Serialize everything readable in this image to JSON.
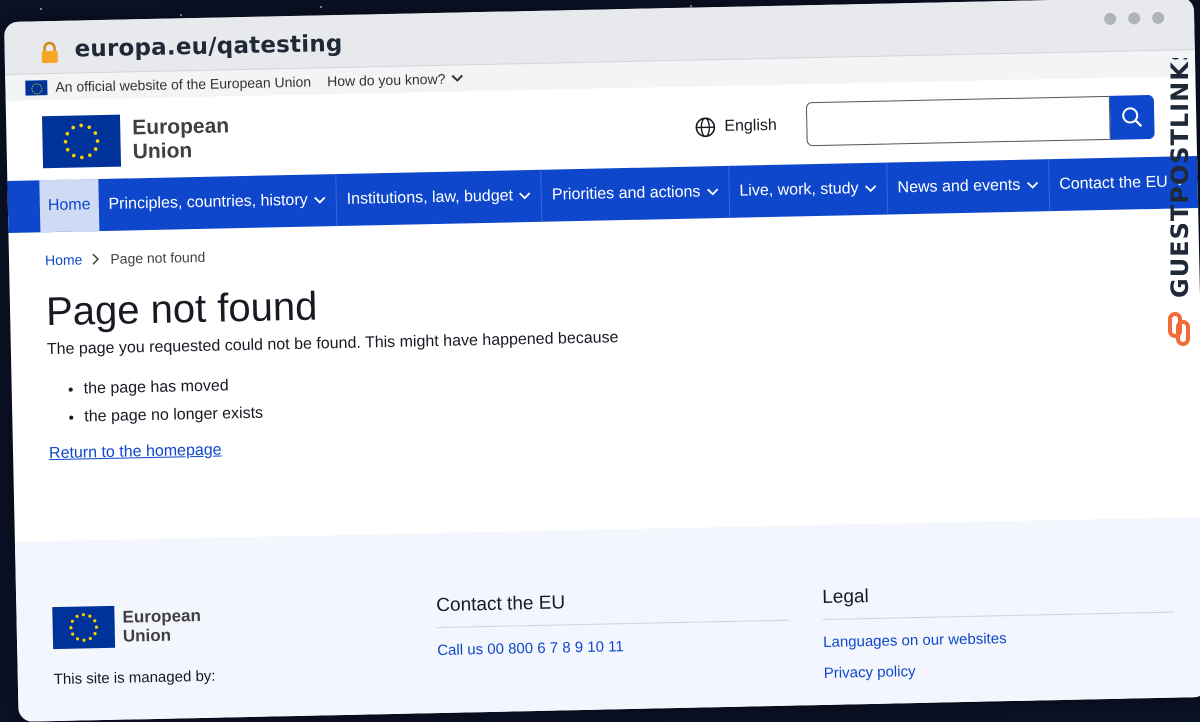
{
  "browser": {
    "url": "europa.eu/qatesting"
  },
  "official_bar": {
    "text": "An official website of the European Union",
    "how_label": "How do you know?"
  },
  "header": {
    "logo_line1": "European",
    "logo_line2": "Union",
    "language": "English",
    "search_placeholder": ""
  },
  "nav": {
    "items": [
      {
        "label": "Home"
      },
      {
        "label": "Principles, countries, history"
      },
      {
        "label": "Institutions, law, budget"
      },
      {
        "label": "Priorities and actions"
      },
      {
        "label": "Live, work, study"
      },
      {
        "label": "News and events"
      },
      {
        "label": "Contact the EU"
      }
    ]
  },
  "breadcrumb": {
    "home": "Home",
    "current": "Page not found"
  },
  "main": {
    "title": "Page not found",
    "lead": "The page you requested could not be found. This might have happened because",
    "reasons": [
      "the page has moved",
      "the page no longer exists"
    ],
    "return_link": "Return to the homepage"
  },
  "footer": {
    "logo_line1": "European",
    "logo_line2": "Union",
    "managed_by": "This site is managed by:",
    "contact": {
      "title": "Contact the EU",
      "links": [
        "Call us 00 800 6 7 8 9 10 11"
      ]
    },
    "legal": {
      "title": "Legal",
      "links": [
        "Languages on our websites",
        "Privacy policy"
      ]
    }
  },
  "watermark": {
    "text": "GUESTPOSTLINKS"
  },
  "colors": {
    "accent": "#0e47cb",
    "flag": "#003399",
    "star": "#ffcc00"
  }
}
